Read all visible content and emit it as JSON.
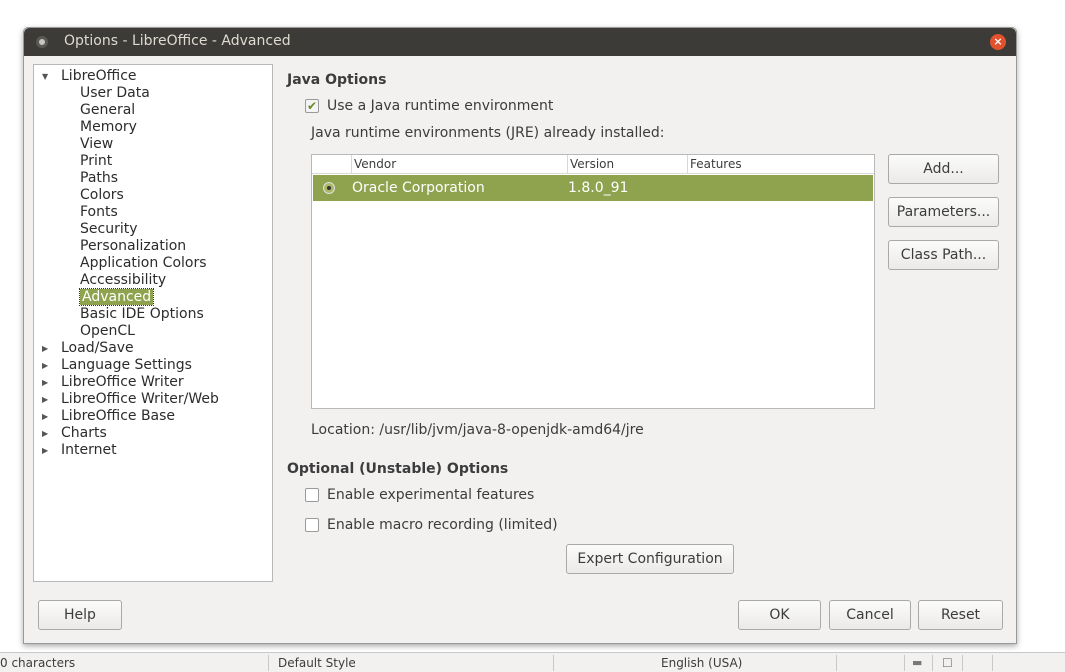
{
  "window": {
    "title": "Options - LibreOffice - Advanced"
  },
  "tree": {
    "root": "LibreOffice",
    "children": [
      "User Data",
      "General",
      "Memory",
      "View",
      "Print",
      "Paths",
      "Colors",
      "Fonts",
      "Security",
      "Personalization",
      "Application Colors",
      "Accessibility",
      "Advanced",
      "Basic IDE Options",
      "OpenCL"
    ],
    "selected": "Advanced",
    "collapsed": [
      "Load/Save",
      "Language Settings",
      "LibreOffice Writer",
      "LibreOffice Writer/Web",
      "LibreOffice Base",
      "Charts",
      "Internet"
    ]
  },
  "java": {
    "title": "Java Options",
    "use_jre_label": "Use a Java runtime environment",
    "use_jre_checked": true,
    "installed_label": "Java runtime environments (JRE) already installed:",
    "columns": [
      "Vendor",
      "Version",
      "Features"
    ],
    "rows": [
      {
        "vendor": "Oracle Corporation",
        "version": "1.8.0_91",
        "features": ""
      }
    ],
    "location": "Location: /usr/lib/jvm/java-8-openjdk-amd64/jre",
    "buttons": {
      "add": "Add...",
      "parameters": "Parameters...",
      "class_path": "Class Path..."
    }
  },
  "optional": {
    "title": "Optional (Unstable) Options",
    "experimental_label": "Enable experimental features",
    "macro_label": "Enable macro recording (limited)",
    "expert_button": "Expert Configuration"
  },
  "footer": {
    "help": "Help",
    "ok": "OK",
    "cancel": "Cancel",
    "reset": "Reset"
  },
  "statusbar": {
    "characters": "0 characters",
    "style": "Default Style",
    "language": "English (USA)"
  },
  "colors": {
    "selection": "#8fa34f",
    "titlebar": "#3c3b37",
    "close": "#e2522f"
  }
}
